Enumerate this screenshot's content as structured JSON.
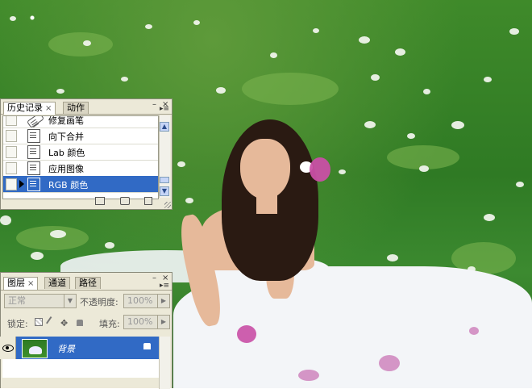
{
  "history_panel": {
    "tabs": [
      {
        "label": "历史记录",
        "close": "×",
        "active": true
      },
      {
        "label": "动作",
        "active": false
      }
    ],
    "window_controls": {
      "minimize": "–",
      "close": "×"
    },
    "items": [
      {
        "label": "修复画笔",
        "selected": false
      },
      {
        "label": "向下合并",
        "selected": false
      },
      {
        "label": "Lab 颜色",
        "selected": false
      },
      {
        "label": "应用图像",
        "selected": false
      },
      {
        "label": "RGB 颜色",
        "selected": true
      }
    ],
    "bottom_icons": [
      "new-document-from-state-icon",
      "snapshot-camera-icon",
      "trash-icon"
    ]
  },
  "layers_panel": {
    "tabs": [
      {
        "label": "图层",
        "close": "×",
        "active": true
      },
      {
        "label": "通道",
        "active": false
      },
      {
        "label": "路径",
        "active": false
      }
    ],
    "window_controls": {
      "minimize": "–",
      "close": "×"
    },
    "blend_mode": "正常",
    "opacity_label": "不透明度:",
    "opacity_value": "100%",
    "lock_label": "锁定:",
    "fill_label": "填充:",
    "fill_value": "100%",
    "layers": [
      {
        "name": "背景",
        "visible": true,
        "locked": true,
        "selected": true
      }
    ]
  },
  "colors": {
    "selection": "#316ac5",
    "panel_bg": "#ece9d8",
    "grass": "#3f8a2a"
  }
}
